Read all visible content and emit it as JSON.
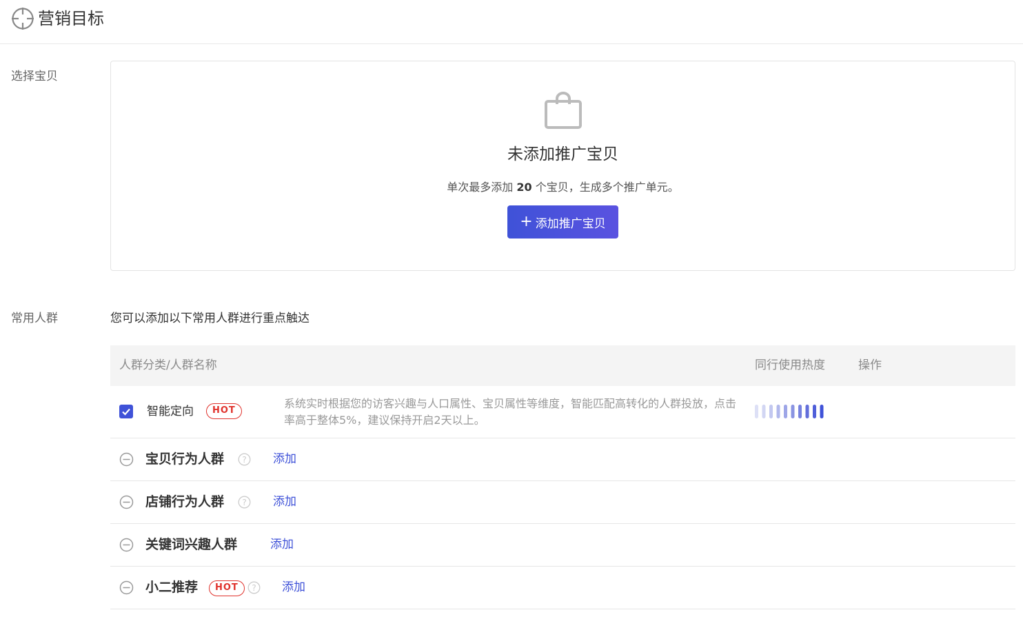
{
  "header": {
    "title": "营销目标",
    "icon": "target-icon"
  },
  "product_section": {
    "label": "选择宝贝",
    "empty_title": "未添加推广宝贝",
    "desc_prefix": "单次最多添加",
    "desc_count": "20",
    "desc_suffix": "个宝贝，生成多个推广单元。",
    "add_button_plus": "+",
    "add_button_label": "添加推广宝贝",
    "icon": "shopping-bag-icon"
  },
  "crowd_section": {
    "label": "常用人群",
    "hint": "您可以添加以下常用人群进行重点触达",
    "columns": {
      "name": "人群分类/人群名称",
      "heat": "同行使用热度",
      "action": "操作"
    },
    "smart": {
      "name": "智能定向",
      "badge": "HOT",
      "checked": true,
      "description": "系统实时根据您的访客兴趣与人口属性、宝贝属性等维度，智能匹配高转化的人群投放，点击率高于整体5%，建议保持开启2天以上。",
      "heat_level": 10
    },
    "groups": [
      {
        "name": "宝贝行为人群",
        "badge": "",
        "help": true,
        "action": "添加"
      },
      {
        "name": "店铺行为人群",
        "badge": "",
        "help": true,
        "action": "添加"
      },
      {
        "name": "关键词兴趣人群",
        "badge": "",
        "help": false,
        "action": "添加"
      },
      {
        "name": "小二推荐",
        "badge": "HOT",
        "help": true,
        "action": "添加"
      }
    ]
  },
  "colors": {
    "primary": "#3f52d8",
    "hot": "#e0322c",
    "muted": "#999999"
  }
}
